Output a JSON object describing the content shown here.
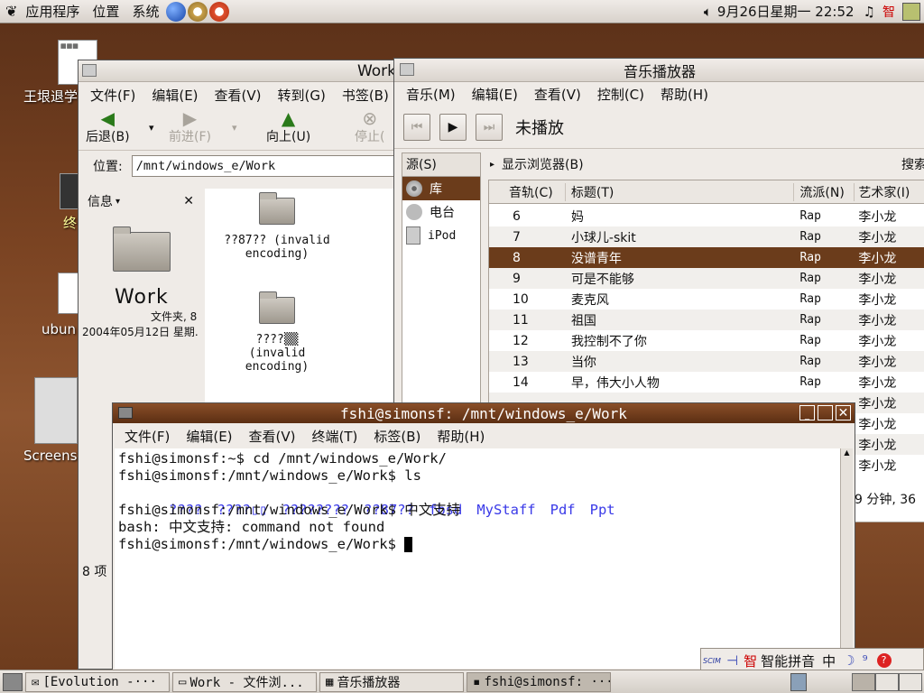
{
  "top_panel": {
    "menus": [
      "应用程序",
      "位置",
      "系统"
    ],
    "clock": "9月26日星期一 22:52",
    "ime_char": "智"
  },
  "desktop": {
    "icon1_label": "王垠退学",
    "icon2_label": "终",
    "icon3_label": "ubun",
    "icon4_label": "Screens"
  },
  "nautilus": {
    "title": "Work",
    "menu": [
      "文件(F)",
      "编辑(E)",
      "查看(V)",
      "转到(G)",
      "书签(B)"
    ],
    "back": "后退(B)",
    "forward": "前进(F)",
    "up": "向上(U)",
    "stop": "停止(",
    "location_label": "位置:",
    "location_value": "/mnt/windows_e/Work",
    "side_title": "信息",
    "folder_name": "Work",
    "folder_type": "文件夹, 8",
    "folder_date": "2004年05月12日 星期.",
    "items": [
      {
        "line1": "??87?? (invalid",
        "line2": "encoding)"
      },
      {
        "line1": "????▒▒",
        "line2": "(invalid",
        "line3": "encoding)"
      }
    ],
    "status": "8 项"
  },
  "rhythmbox": {
    "title": "音乐播放器",
    "menu": [
      "音乐(M)",
      "编辑(E)",
      "查看(V)",
      "控制(C)",
      "帮助(H)"
    ],
    "now_playing": "未播放",
    "source_header": "源(S)",
    "sources": [
      "库",
      "电台",
      "iPod"
    ],
    "browser_toggle": "显示浏览器(B)",
    "search": "搜索",
    "columns": [
      "音轨(C)",
      "标题(T)",
      "流派(N)",
      "艺术家(I)"
    ],
    "tracks": [
      {
        "num": "6",
        "title": "妈",
        "genre": "Rap",
        "artist": "李小龙"
      },
      {
        "num": "7",
        "title": "小球儿-skit",
        "genre": "Rap",
        "artist": "李小龙"
      },
      {
        "num": "8",
        "title": "没谱青年",
        "genre": "Rap",
        "artist": "李小龙"
      },
      {
        "num": "9",
        "title": "可是不能够",
        "genre": "Rap",
        "artist": "李小龙"
      },
      {
        "num": "10",
        "title": "麦克风",
        "genre": "Rap",
        "artist": "李小龙"
      },
      {
        "num": "11",
        "title": "祖国",
        "genre": "Rap",
        "artist": "李小龙"
      },
      {
        "num": "12",
        "title": "我控制不了你",
        "genre": "Rap",
        "artist": "李小龙"
      },
      {
        "num": "13",
        "title": "当你",
        "genre": "Rap",
        "artist": "李小龙"
      },
      {
        "num": "14",
        "title": "早，伟大小人物",
        "genre": "Rap",
        "artist": "李小龙"
      }
    ],
    "hidden_artists": [
      "李小龙",
      "李小龙",
      "李小龙",
      "李小龙"
    ],
    "status": "9 分钟, 36"
  },
  "terminal": {
    "title": "fshi@simonsf: /mnt/windows_e/Work",
    "menu": [
      "文件(F)",
      "编辑(E)",
      "查看(V)",
      "终端(T)",
      "标签(B)",
      "帮助(H)"
    ],
    "line1": "fshi@simonsf:~$ cd /mnt/windows_e/Work/",
    "line2": "fshi@simonsf:/mnt/windows_e/Work$ ls",
    "ls_items": [
      "????",
      "????▯▯",
      "????????",
      "??87??",
      "fbsd",
      "MyStaff",
      "Pdf",
      "Ppt"
    ],
    "line4": "fshi@simonsf:/mnt/windows_e/Work$ 中文支持",
    "line5": "bash: 中文支持: command not found",
    "line6": "fshi@simonsf:/mnt/windows_e/Work$ "
  },
  "ime_bar": {
    "logo": "SCIM",
    "mode": "智能拼音",
    "lang": "中"
  },
  "taskbar": {
    "tasks": [
      "[Evolution -···",
      "Work - 文件浏...",
      "音乐播放器",
      "fshi@simonsf: ···"
    ]
  }
}
